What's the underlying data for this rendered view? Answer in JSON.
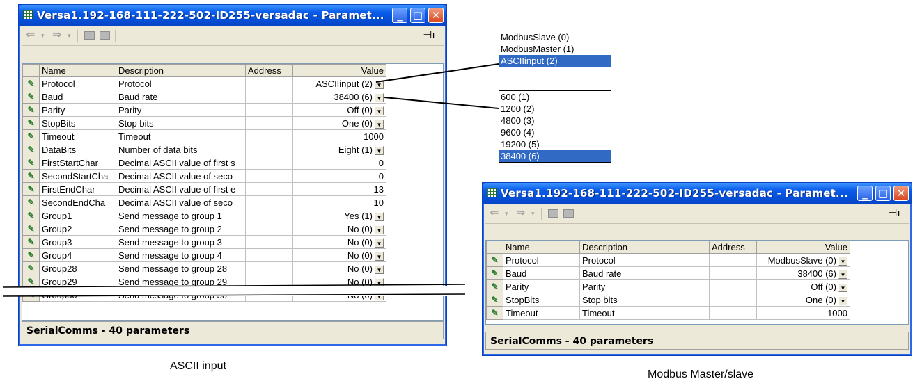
{
  "window_left": {
    "title": "Versa1.192-168-111-222-502-ID255-versadac - Paramet...",
    "columns": [
      "Name",
      "Description",
      "Address",
      "Value"
    ],
    "rows": [
      {
        "name": "Protocol",
        "desc": "Protocol",
        "addr": "",
        "value": "ASCIIinput (2)",
        "dd": true
      },
      {
        "name": "Baud",
        "desc": "Baud rate",
        "addr": "",
        "value": "38400 (6)",
        "dd": true
      },
      {
        "name": "Parity",
        "desc": "Parity",
        "addr": "",
        "value": "Off (0)",
        "dd": true
      },
      {
        "name": "StopBits",
        "desc": "Stop bits",
        "addr": "",
        "value": "One (0)",
        "dd": true
      },
      {
        "name": "Timeout",
        "desc": "Timeout",
        "addr": "",
        "value": "1000",
        "dd": false
      },
      {
        "name": "DataBits",
        "desc": "Number of data bits",
        "addr": "",
        "value": "Eight (1)",
        "dd": true
      },
      {
        "name": "FirstStartChar",
        "desc": "Decimal ASCII value of first s",
        "addr": "",
        "value": "0",
        "dd": false
      },
      {
        "name": "SecondStartCha",
        "desc": "Decimal ASCII value of seco",
        "addr": "",
        "value": "0",
        "dd": false
      },
      {
        "name": "FirstEndChar",
        "desc": "Decimal ASCII value of first e",
        "addr": "",
        "value": "13",
        "dd": false
      },
      {
        "name": "SecondEndCha",
        "desc": "Decimal ASCII value of seco",
        "addr": "",
        "value": "10",
        "dd": false
      },
      {
        "name": "Group1",
        "desc": "Send message to group 1",
        "addr": "",
        "value": "Yes (1)",
        "dd": true
      },
      {
        "name": "Group2",
        "desc": "Send message to group 2",
        "addr": "",
        "value": "No (0)",
        "dd": true
      },
      {
        "name": "Group3",
        "desc": "Send message to group 3",
        "addr": "",
        "value": "No (0)",
        "dd": true
      },
      {
        "name": "Group4",
        "desc": "Send message to group 4",
        "addr": "",
        "value": "No (0)",
        "dd": true
      },
      {
        "name": "Group28",
        "desc": "Send message to group 28",
        "addr": "",
        "value": "No (0)",
        "dd": true
      },
      {
        "name": "Group29",
        "desc": "Send message to group 29",
        "addr": "",
        "value": "No (0)",
        "dd": true
      },
      {
        "name": "Group30",
        "desc": "Send message to group 30",
        "addr": "",
        "value": "No (0)",
        "dd": true
      }
    ],
    "status": "SerialComms  -  40 parameters"
  },
  "window_right": {
    "title": "Versa1.192-168-111-222-502-ID255-versadac - Paramet...",
    "columns": [
      "Name",
      "Description",
      "Address",
      "Value"
    ],
    "rows": [
      {
        "name": "Protocol",
        "desc": "Protocol",
        "addr": "",
        "value": "ModbusSlave (0)",
        "dd": true
      },
      {
        "name": "Baud",
        "desc": "Baud rate",
        "addr": "",
        "value": "38400 (6)",
        "dd": true
      },
      {
        "name": "Parity",
        "desc": "Parity",
        "addr": "",
        "value": "Off (0)",
        "dd": true
      },
      {
        "name": "StopBits",
        "desc": "Stop bits",
        "addr": "",
        "value": "One (0)",
        "dd": true
      },
      {
        "name": "Timeout",
        "desc": "Timeout",
        "addr": "",
        "value": "1000",
        "dd": false
      }
    ],
    "status": "SerialComms  -  40 parameters"
  },
  "protocol_options": {
    "items": [
      "ModbusSlave (0)",
      "ModbusMaster (1)",
      "ASCIIinput (2)"
    ],
    "selected": "ASCIIinput (2)"
  },
  "baud_options": {
    "items": [
      "600 (1)",
      "1200 (2)",
      "4800 (3)",
      "9600 (4)",
      "19200 (5)",
      "38400 (6)"
    ],
    "selected": "38400 (6)"
  },
  "captions": {
    "left": "ASCII input",
    "right": "Modbus Master/slave"
  },
  "colors": {
    "titlebar": "#0a5ce9",
    "selection": "#316ac5",
    "pencil": "#2e7d32"
  }
}
